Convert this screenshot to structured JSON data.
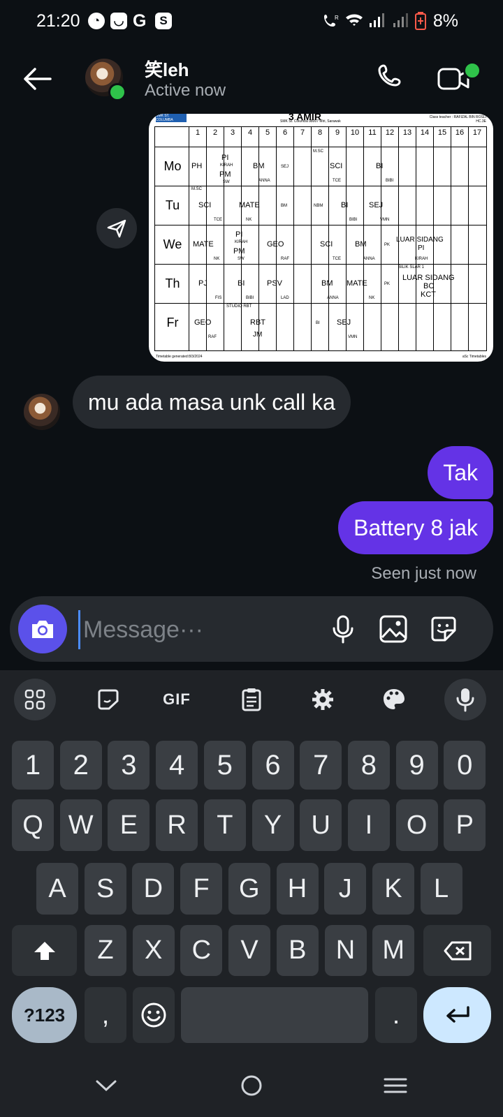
{
  "status_bar": {
    "time": "21:20",
    "app_icons": [
      "speedometer-icon",
      "shopping-bag-icon",
      "google-icon",
      "s-icon"
    ],
    "battery": "8%"
  },
  "header": {
    "contact_name": "笑leh",
    "presence": "Active now"
  },
  "timetable": {
    "school_logo": "SMK ST. COLUMBA",
    "title": "3 AMIR",
    "school": "SMK St. Columba 98007 Miri, Sarawak",
    "class_teacher": "Class teacher : RAFIZAL BIN ROSLI",
    "class_code": "HC.3E",
    "periods": [
      "1",
      "2",
      "3",
      "4",
      "5",
      "6",
      "7",
      "8",
      "9",
      "10",
      "11",
      "12",
      "13",
      "14",
      "15",
      "16",
      "17"
    ],
    "days": [
      "Mo",
      "Tu",
      "We",
      "Th",
      "Fr"
    ],
    "cells": {
      "mo": [
        "PH",
        "PI",
        "KIRAH",
        "PM",
        "SW",
        "BM",
        "ANNA",
        "SEJ",
        "M.SC",
        "SCI",
        "TCE",
        "BI",
        "BIBI"
      ],
      "tu": [
        "M.SC",
        "SCI",
        "TCE",
        "MATE",
        "NK",
        "BM",
        "NBM",
        "BI",
        "BIBI",
        "SEJ",
        "VMN"
      ],
      "we": [
        "MATE",
        "NK",
        "PI",
        "KIRAH",
        "PM",
        "SW",
        "GEO",
        "RAF",
        "SCI",
        "TCE",
        "BM",
        "ANNA",
        "PK",
        "LUAR SIDANG",
        "PI",
        "KIRAH"
      ],
      "th": [
        "PJ",
        "FIS",
        "BI",
        "BIBI",
        "PSV",
        "LAD",
        "BM",
        "ANNA",
        "MATE",
        "NK",
        "PK",
        "BILIK SLAR 1",
        "LUAR SIDANG",
        "BC",
        "KCT"
      ],
      "fr": [
        "GEO",
        "RAF",
        "STUDIO RBT",
        "RBT",
        "JM",
        "BI",
        "SEJ",
        "VMN"
      ]
    },
    "footer_left": "Timetable generated:8/3/2024",
    "footer_right": "aSc Timetables"
  },
  "messages": {
    "incoming": "mu ada masa unk call ka",
    "outgoing": [
      "Tak",
      "Battery 8 jak"
    ],
    "seen": "Seen just now"
  },
  "composer": {
    "placeholder": "Message···"
  },
  "keyboard": {
    "toolbar": {
      "gif_label": "GIF"
    },
    "row_numbers": [
      "1",
      "2",
      "3",
      "4",
      "5",
      "6",
      "7",
      "8",
      "9",
      "0"
    ],
    "row_1": [
      "Q",
      "W",
      "E",
      "R",
      "T",
      "Y",
      "U",
      "I",
      "O",
      "P"
    ],
    "row_2": [
      "A",
      "S",
      "D",
      "F",
      "G",
      "H",
      "J",
      "K",
      "L"
    ],
    "row_3": [
      "Z",
      "X",
      "C",
      "V",
      "B",
      "N",
      "M"
    ],
    "symbols_key": "?123",
    "comma_key": ",",
    "period_key": "."
  },
  "colors": {
    "background": "#0c1014",
    "bubble_out": "#6433e6",
    "bubble_in": "#262a2f",
    "online": "#2fc24a",
    "camera": "#5b51ea"
  }
}
